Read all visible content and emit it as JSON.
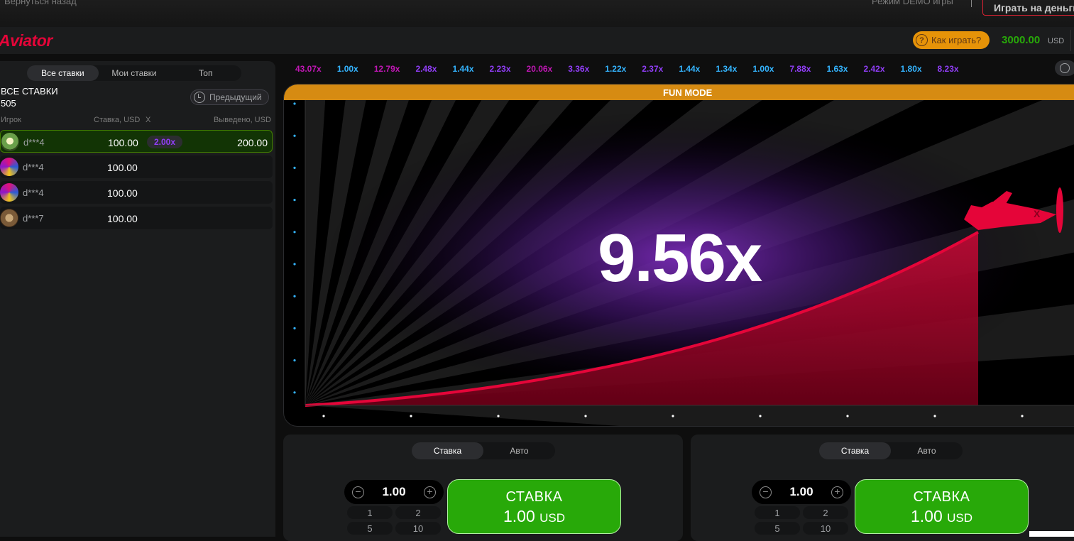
{
  "topbar": {
    "back": "Вернуться назад",
    "demo": "Режим DEMO игры",
    "play_money": "Играть на деньги"
  },
  "header": {
    "logo": "Aviator",
    "howto": "Как играть?",
    "howto_icon": "question-icon",
    "balance": "3000.00",
    "currency": "USD"
  },
  "sidebar": {
    "tabs": [
      "Все ставки",
      "Мои ставки",
      "Топ"
    ],
    "title": "ВСЕ СТАВКИ",
    "count": "505",
    "prev_button": "Предыдущий",
    "columns": {
      "player": "Игрок",
      "stake": "Ставка, USD",
      "x": "X",
      "cashout": "Выведено, USD"
    },
    "rows": [
      {
        "user": "d***4",
        "amount": "100.00",
        "mult": "2.00x",
        "out": "200.00"
      },
      {
        "user": "d***4",
        "amount": "100.00",
        "mult": "",
        "out": ""
      },
      {
        "user": "d***4",
        "amount": "100.00",
        "mult": "",
        "out": ""
      },
      {
        "user": "d***7",
        "amount": "100.00",
        "mult": "",
        "out": ""
      }
    ]
  },
  "history": [
    {
      "v": "43.07x",
      "c": "#c017b4"
    },
    {
      "v": "1.00x",
      "c": "#34b4ff"
    },
    {
      "v": "12.79x",
      "c": "#c017b4"
    },
    {
      "v": "2.48x",
      "c": "#913ef8"
    },
    {
      "v": "1.44x",
      "c": "#34b4ff"
    },
    {
      "v": "2.23x",
      "c": "#913ef8"
    },
    {
      "v": "20.06x",
      "c": "#c017b4"
    },
    {
      "v": "3.36x",
      "c": "#913ef8"
    },
    {
      "v": "1.22x",
      "c": "#34b4ff"
    },
    {
      "v": "2.37x",
      "c": "#913ef8"
    },
    {
      "v": "1.44x",
      "c": "#34b4ff"
    },
    {
      "v": "1.34x",
      "c": "#34b4ff"
    },
    {
      "v": "1.00x",
      "c": "#34b4ff"
    },
    {
      "v": "7.88x",
      "c": "#913ef8"
    },
    {
      "v": "1.63x",
      "c": "#34b4ff"
    },
    {
      "v": "2.42x",
      "c": "#913ef8"
    },
    {
      "v": "1.80x",
      "c": "#34b4ff"
    },
    {
      "v": "8.23x",
      "c": "#913ef8"
    }
  ],
  "game": {
    "mode": "FUN MODE",
    "multiplier": "9.56x"
  },
  "panels": [
    {
      "tabs": [
        "Ставка",
        "Авто"
      ],
      "value": "1.00",
      "quick": [
        "1",
        "2",
        "5",
        "10"
      ],
      "bet_label": "СТАВКА",
      "bet_amount": "1.00",
      "bet_cur": "USD"
    },
    {
      "tabs": [
        "Ставка",
        "Авто"
      ],
      "value": "1.00",
      "quick": [
        "1",
        "2",
        "5",
        "10"
      ],
      "bet_label": "СТАВКА",
      "bet_amount": "1.00",
      "bet_cur": "USD"
    }
  ],
  "colors": {
    "accent_red": "#e50539",
    "green": "#28a909",
    "orange": "#d68b12",
    "purple": "#913ef8",
    "blue": "#34b4ff",
    "pink": "#c017b4"
  }
}
